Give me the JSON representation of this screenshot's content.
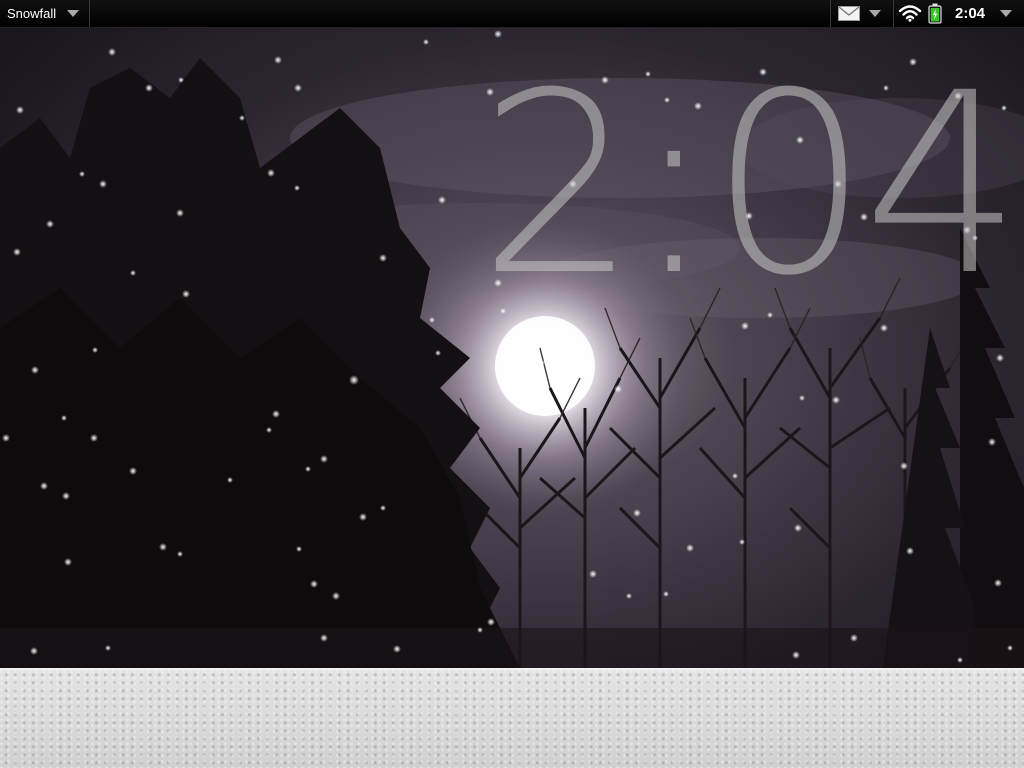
{
  "status_bar": {
    "app_title": "Snowfall",
    "clock": "2:04",
    "icons": {
      "app_menu": "chevron-down-icon",
      "mail": "mail-icon",
      "notifications": "chevron-down-icon",
      "wifi": "wifi-icon",
      "battery": "battery-icon",
      "device_menu": "chevron-down-icon"
    },
    "battery_color": "#39c427"
  },
  "wallpaper": {
    "clock": "2:04",
    "clock_color": "#c8c8c8",
    "sky_color": "#2c2730",
    "moon_color": "#ffffff",
    "ground_color": "#d6d6d6"
  }
}
